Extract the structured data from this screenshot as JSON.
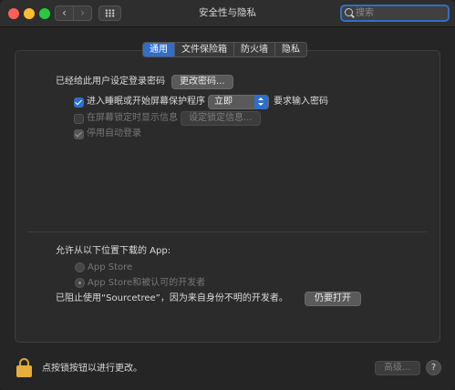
{
  "window": {
    "title": "安全性与隐私",
    "back_glyph": "‹",
    "forward_glyph": "›"
  },
  "search": {
    "placeholder": "搜索"
  },
  "tabs": [
    {
      "label": "通用",
      "active": true
    },
    {
      "label": "文件保险箱",
      "active": false
    },
    {
      "label": "防火墙",
      "active": false
    },
    {
      "label": "隐私",
      "active": false
    }
  ],
  "general": {
    "password_set_label": "已经给此用户设定登录密码",
    "change_password_button": "更改密码...",
    "require_password": {
      "checkbox_label": "进入睡眠或开始屏幕保护程序",
      "checked": true,
      "select_value": "立即",
      "suffix": "要求输入密码"
    },
    "show_message": {
      "checkbox_label": "在屏幕锁定时显示信息",
      "checked": false,
      "enabled": false,
      "button": "设定锁定信息..."
    },
    "disable_autologin": {
      "checkbox_label": "停用自动登录",
      "checked": true,
      "enabled": false
    }
  },
  "downloads": {
    "heading": "允许从以下位置下载的 App:",
    "options": [
      {
        "label": "App Store",
        "selected": false
      },
      {
        "label": "App Store和被认可的开发者",
        "selected": true
      }
    ],
    "blocked_message": "已阻止使用“Sourcetree”，因为来自身份不明的开发者。",
    "open_anyway_button": "仍要打开"
  },
  "footer": {
    "lock_text": "点按锁按钮以进行更改。",
    "advanced_button": "高级...",
    "help_label": "?"
  },
  "colors": {
    "accent": "#2f6ec9",
    "lock": "#e6ae3a",
    "close": "#fe5f57",
    "minimize": "#febc2e",
    "zoom": "#28c840"
  }
}
